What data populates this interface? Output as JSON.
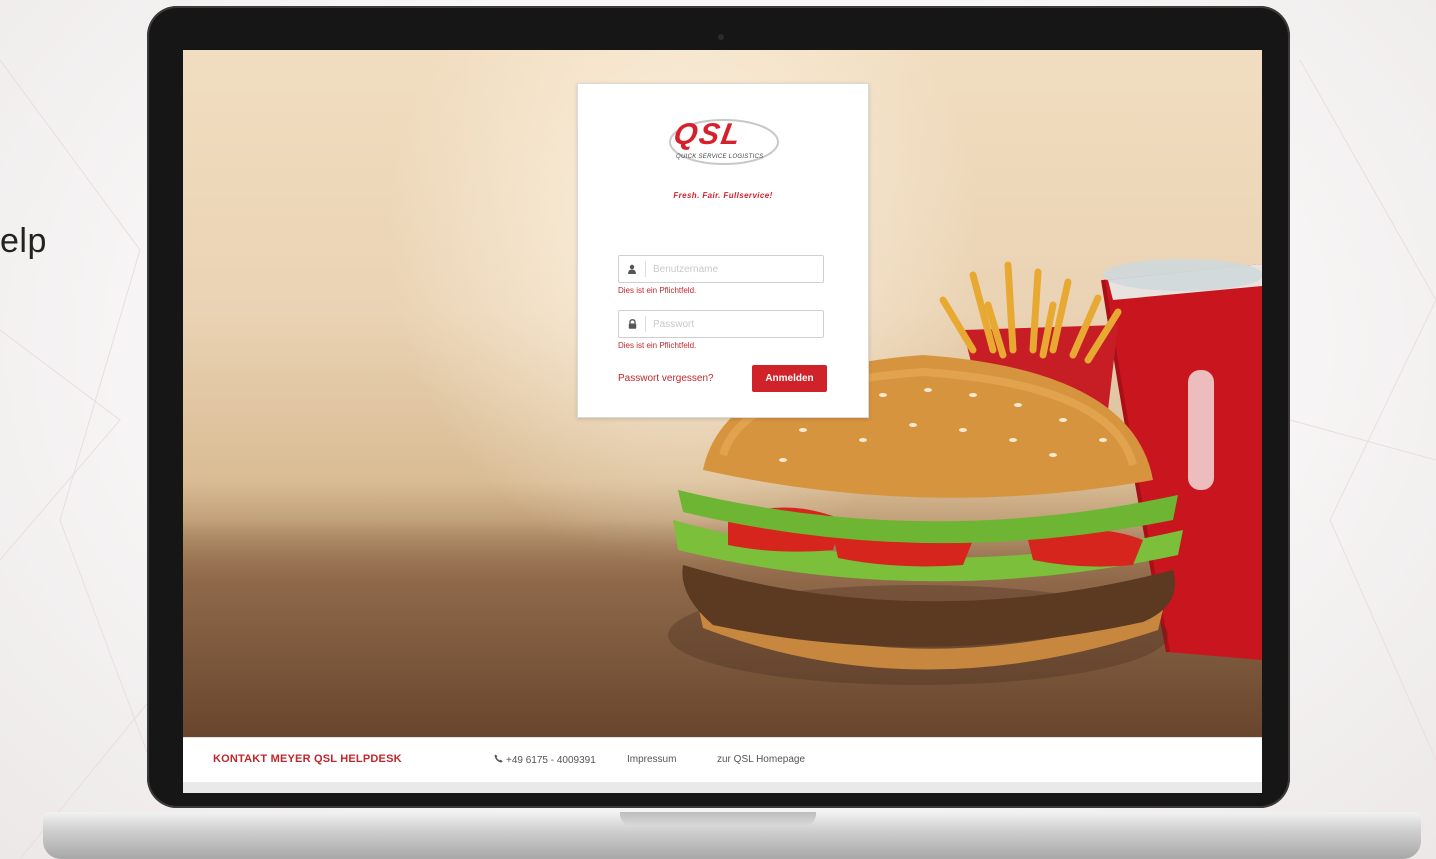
{
  "edge_text": "elp",
  "login": {
    "logo_text": "QSL",
    "logo_subtitle": "QUICK SERVICE LOGISTICS",
    "slogan": "Fresh. Fair. Fullservice!",
    "username_placeholder": "Benutzername",
    "username_error": "Dies ist ein Pflichtfeld.",
    "password_placeholder": "Passwort",
    "password_error": "Dies ist ein Pflichtfeld.",
    "forgot_label": "Passwort vergessen?",
    "submit_label": "Anmelden"
  },
  "footer": {
    "brand": "KONTAKT MEYER QSL HELPDESK",
    "phone": "+49 6175 - 4009391",
    "impressum": "Impressum",
    "homepage": "zur QSL Homepage"
  },
  "colors": {
    "accent": "#cf2229",
    "bezel": "#161616"
  },
  "icons": [
    "user-icon",
    "lock-icon",
    "phone-icon"
  ]
}
